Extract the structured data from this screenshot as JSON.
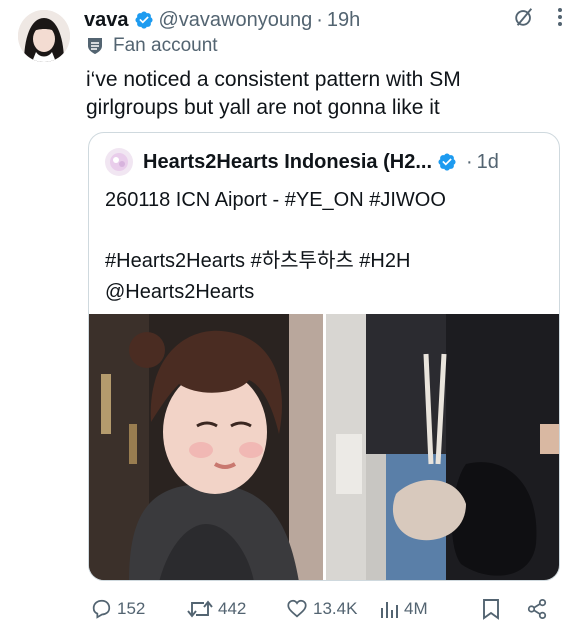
{
  "author": {
    "name": "vava",
    "handle": "@vavawonyoung",
    "separator": "·",
    "time": "19h",
    "label": "Fan account"
  },
  "tweet": {
    "text": "i‘ve noticed a consistent pattern with SM girlgroups but yall are not gonna like it"
  },
  "quote": {
    "name": "Hearts2Hearts Indonesia (H2...",
    "separator": "·",
    "time": "1d",
    "lines": [
      "260118 ICN Aiport - #YE_ON #JIWOO",
      "#Hearts2Hearts #하츠투하츠 #H2H",
      "@Hearts2Hearts"
    ]
  },
  "actions": {
    "replies": "152",
    "reposts": "442",
    "likes": "13.4K",
    "views": "4M"
  },
  "colors": {
    "text": "#0f1419",
    "secondary": "#536471",
    "verified": "#1d9bf0",
    "border": "#cfd9de"
  },
  "icons": {
    "reply": "reply-icon",
    "repost": "repost-icon",
    "like": "heart-icon",
    "views": "views-icon",
    "bookmark": "bookmark-icon",
    "share": "share-icon",
    "grok": "grok-icon",
    "more": "more-icon"
  }
}
